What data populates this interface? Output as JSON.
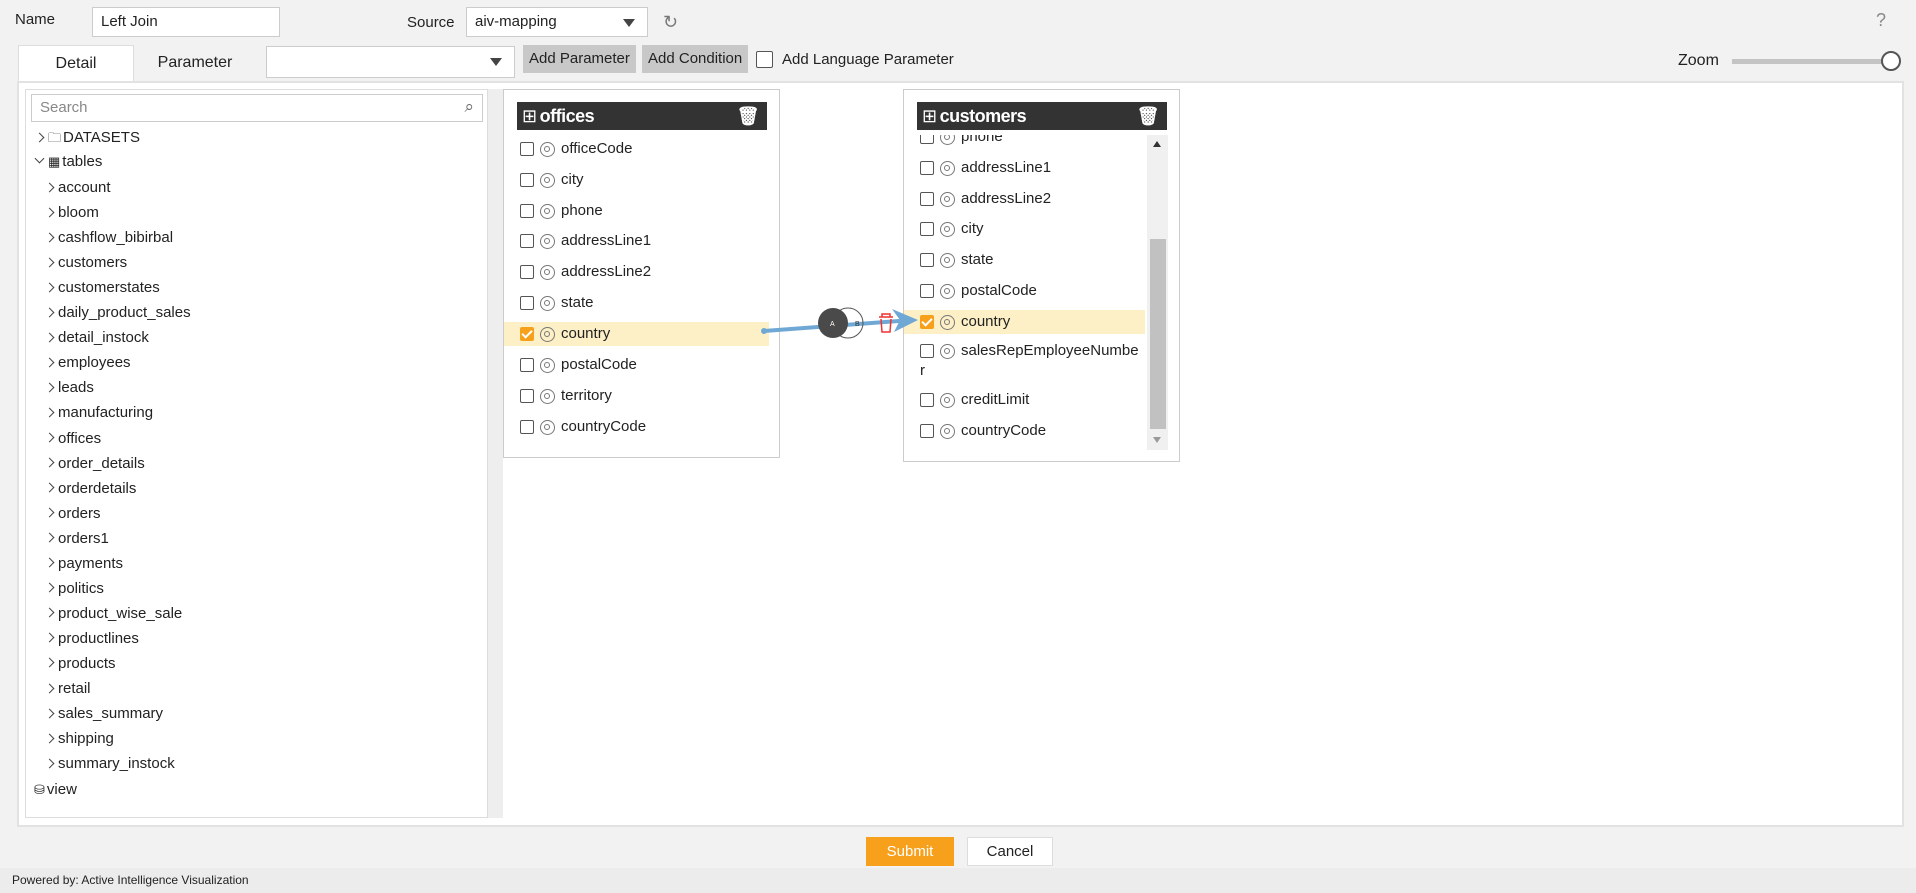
{
  "header": {
    "name_label": "Name",
    "name_value": "Left Join",
    "source_label": "Source",
    "source_value": "aiv-mapping",
    "help": "?"
  },
  "toolbar": {
    "tabs": [
      {
        "label": "Detail",
        "active": true
      },
      {
        "label": "Parameter",
        "active": false
      }
    ],
    "parameter_select": "",
    "add_parameter": "Add Parameter",
    "add_condition": "Add Condition",
    "add_language_parameter": "Add Language Parameter",
    "add_language_checked": false,
    "zoom_label": "Zoom",
    "zoom_level": 1.0
  },
  "sidebar": {
    "search_placeholder": "Search",
    "datasets": "DATASETS",
    "tables": "tables",
    "view": "view",
    "items": [
      "account",
      "bloom",
      "cashflow_bibirbal",
      "customers",
      "customerstates",
      "daily_product_sales",
      "detail_instock",
      "employees",
      "leads",
      "manufacturing",
      "offices",
      "order_details",
      "orderdetails",
      "orders",
      "orders1",
      "payments",
      "politics",
      "product_wise_sale",
      "productlines",
      "products",
      "retail",
      "sales_summary",
      "shipping",
      "summary_instock"
    ]
  },
  "canvas": {
    "offices": {
      "title": "offices",
      "columns": [
        {
          "name": "officeCode",
          "checked": false
        },
        {
          "name": "city",
          "checked": false
        },
        {
          "name": "phone",
          "checked": false
        },
        {
          "name": "addressLine1",
          "checked": false
        },
        {
          "name": "addressLine2",
          "checked": false
        },
        {
          "name": "state",
          "checked": false
        },
        {
          "name": "country",
          "checked": true
        },
        {
          "name": "postalCode",
          "checked": false
        },
        {
          "name": "territory",
          "checked": false
        },
        {
          "name": "countryCode",
          "checked": false
        }
      ]
    },
    "customers": {
      "title": "customers",
      "columns": [
        {
          "name": "phone",
          "checked": false
        },
        {
          "name": "addressLine1",
          "checked": false
        },
        {
          "name": "addressLine2",
          "checked": false
        },
        {
          "name": "city",
          "checked": false
        },
        {
          "name": "state",
          "checked": false
        },
        {
          "name": "postalCode",
          "checked": false
        },
        {
          "name": "country",
          "checked": true
        },
        {
          "name": "salesRepEmployeeNumber",
          "checked": false
        },
        {
          "name": "creditLimit",
          "checked": false
        },
        {
          "name": "countryCode",
          "checked": false
        }
      ]
    },
    "join": {
      "left_label": "A",
      "right_label": "B",
      "line_color": "#6fa8d4"
    }
  },
  "footer": {
    "submit": "Submit",
    "cancel": "Cancel",
    "powered_by": "Powered by: Active Intelligence Visualization",
    "accent": "#f7a01b"
  }
}
